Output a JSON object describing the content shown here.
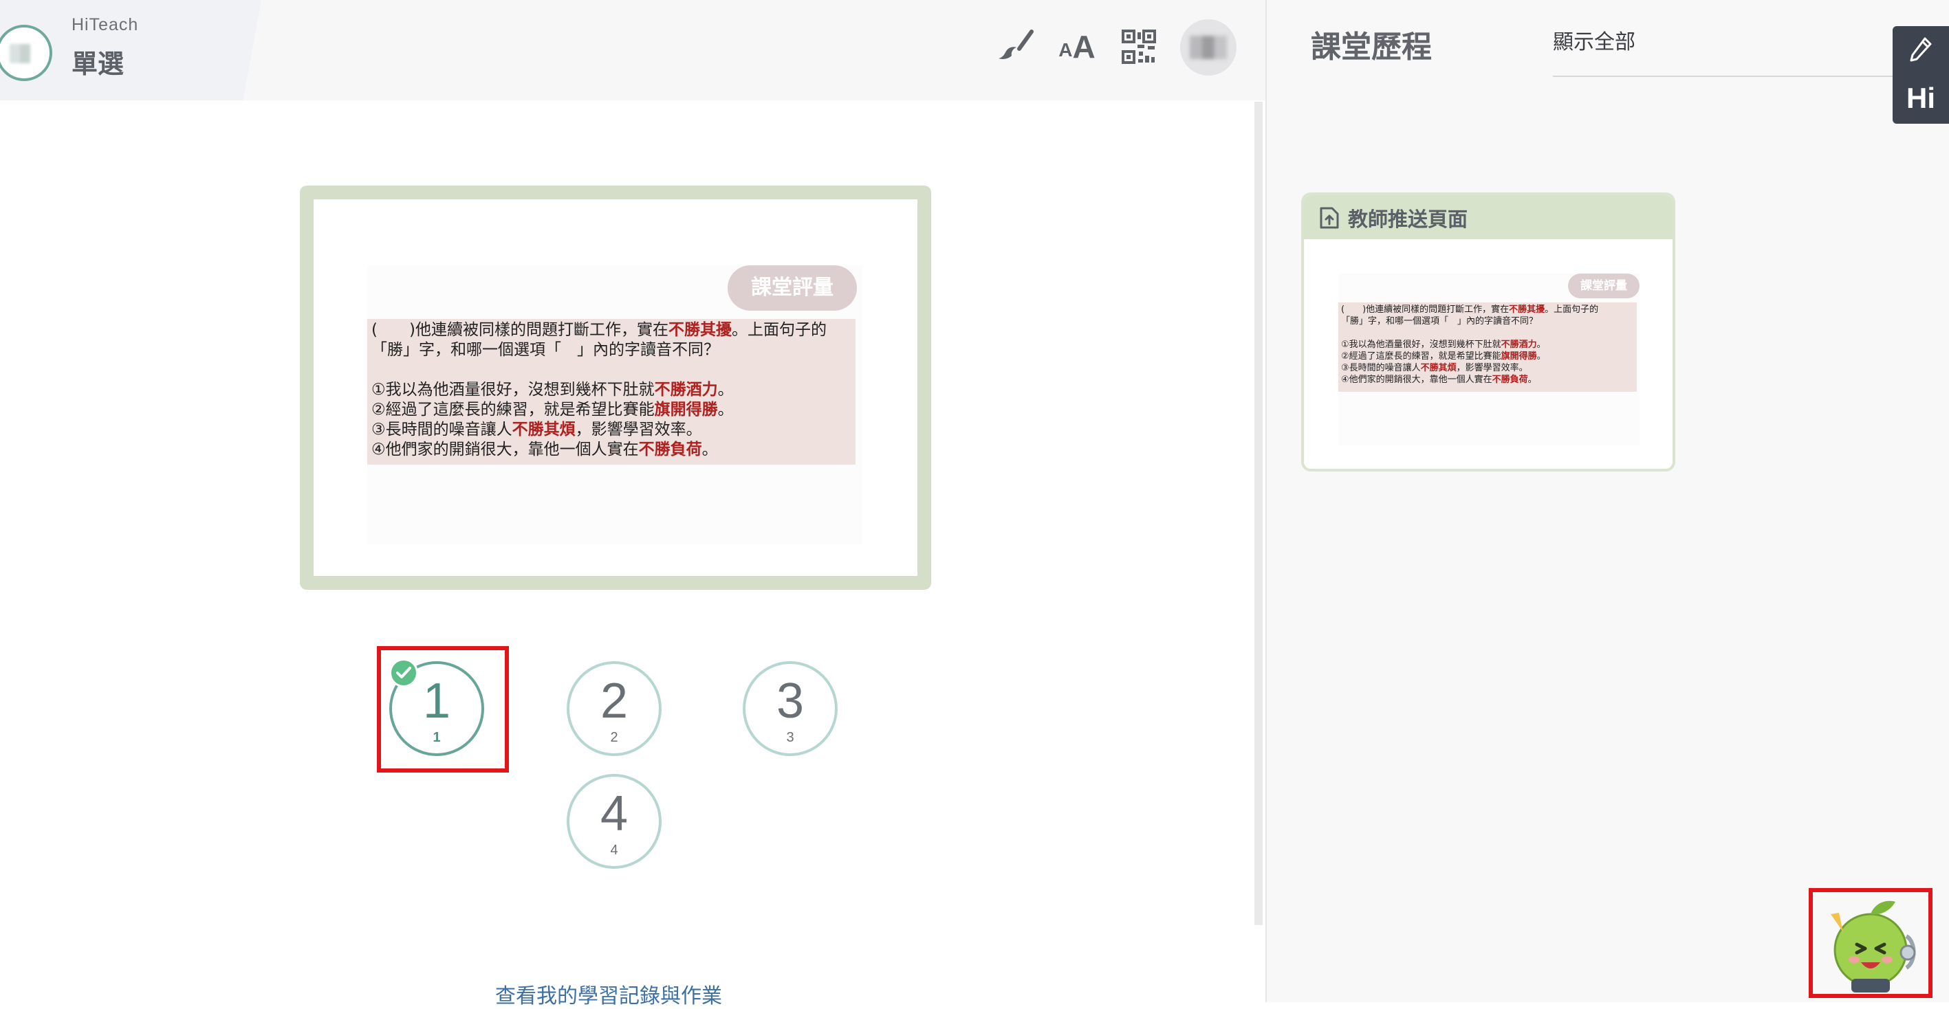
{
  "header": {
    "app_name": "HiTeach",
    "mode_title": "單選",
    "icons": [
      "brush-icon",
      "font-size-icon",
      "qr-code-icon",
      "avatar"
    ],
    "font_icon_text": "AA"
  },
  "slide": {
    "badge": "課堂評量",
    "question": [
      {
        "t": "(　　)他連續被同樣的問題打斷工作，實在"
      },
      {
        "t": "不勝其擾",
        "hl": true
      },
      {
        "t": "。上面句子的\n「勝」字，和哪一個選項「　」內的字讀音不同？\n\n①我以為他酒量很好，沒想到幾杯下肚就"
      },
      {
        "t": "不勝酒力",
        "hl": true
      },
      {
        "t": "。\n②經過了這麼長的練習，就是希望比賽能"
      },
      {
        "t": "旗開得勝",
        "hl": true
      },
      {
        "t": "。\n③長時間的噪音讓人"
      },
      {
        "t": "不勝其煩",
        "hl": true
      },
      {
        "t": "，影響學習效率。\n④他們家的開銷很大，靠他一個人實在"
      },
      {
        "t": "不勝負荷",
        "hl": true
      },
      {
        "t": "。"
      }
    ]
  },
  "choices": [
    {
      "num": "1",
      "sub": "1",
      "selected": true
    },
    {
      "num": "2",
      "sub": "2",
      "selected": false
    },
    {
      "num": "3",
      "sub": "3",
      "selected": false
    },
    {
      "num": "4",
      "sub": "4",
      "selected": false
    }
  ],
  "footer": {
    "history_link": "查看我的學習記錄與作業"
  },
  "right_panel": {
    "title": "課堂歷程",
    "filter_value": "顯示全部",
    "push_card_title": "教師推送頁面",
    "hi_button": "Hi"
  },
  "colors": {
    "accent": "#66a597",
    "frame": "#d4dec8",
    "highlight": "#b0201e",
    "selection_outline": "#e0161b",
    "check": "#5bbf87"
  }
}
